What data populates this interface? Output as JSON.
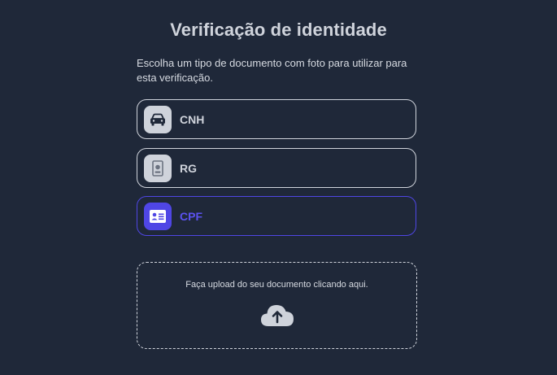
{
  "page": {
    "title": "Verificação de identidade",
    "subtitle": "Escolha um tipo de documento com foto para utilizar para esta verificação."
  },
  "options": [
    {
      "label": "CNH",
      "icon": "car-icon",
      "selected": false
    },
    {
      "label": "RG",
      "icon": "id-badge-icon",
      "selected": false
    },
    {
      "label": "CPF",
      "icon": "id-card-icon",
      "selected": true
    }
  ],
  "upload": {
    "text": "Faça upload do seu documento clicando aqui.",
    "icon": "cloud-upload-icon"
  },
  "colors": {
    "background": "#1f2839",
    "text": "#cfd3db",
    "accent": "#4f46e5"
  }
}
